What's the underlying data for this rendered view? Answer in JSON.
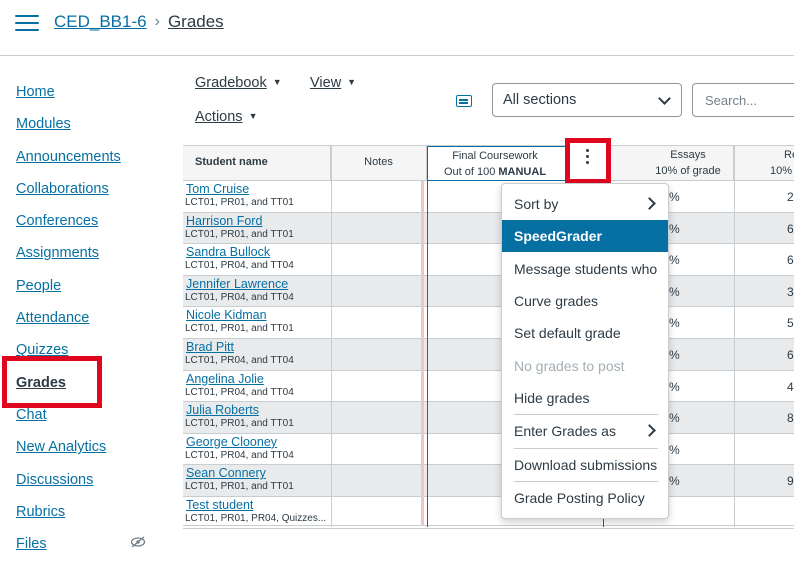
{
  "header": {
    "course": "CED_BB1-6",
    "separator": "›",
    "current": "Grades"
  },
  "sidenav": {
    "items": [
      {
        "label": "Home"
      },
      {
        "label": "Modules"
      },
      {
        "label": "Announcements"
      },
      {
        "label": "Collaborations"
      },
      {
        "label": "Conferences"
      },
      {
        "label": "Assignments"
      },
      {
        "label": "People"
      },
      {
        "label": "Attendance"
      },
      {
        "label": "Quizzes"
      },
      {
        "label": "Grades"
      },
      {
        "label": "Chat"
      },
      {
        "label": "New Analytics"
      },
      {
        "label": "Discussions"
      },
      {
        "label": "Rubrics"
      },
      {
        "label": "Files"
      }
    ],
    "files_icon": "eye-slash-icon"
  },
  "toolbar": {
    "gradebook": "Gradebook",
    "view": "View",
    "actions": "Actions",
    "caret": "▼",
    "sections_select": "All sections",
    "search_placeholder": "Search..."
  },
  "grid": {
    "headers": {
      "student": "Student name",
      "notes": "Notes",
      "final_title": "Final Coursework",
      "final_sub": "Out of 100",
      "final_flag": "MANUAL",
      "essays_title": "Essays",
      "essays_sub": "10% of grade",
      "next_title": "Re",
      "next_sub": "10%"
    },
    "rows": [
      {
        "name": "Tom Cruise",
        "sections": "LCT01, PR01, and TT01",
        "pct": "%",
        "next": "2"
      },
      {
        "name": "Harrison Ford",
        "sections": "LCT01, PR01, and TT01",
        "pct": "%",
        "next": "6"
      },
      {
        "name": "Sandra Bullock",
        "sections": "LCT01, PR04, and TT04",
        "pct": "%",
        "next": "6"
      },
      {
        "name": "Jennifer Lawrence",
        "sections": "LCT01, PR04, and TT04",
        "pct": "%",
        "next": "3"
      },
      {
        "name": "Nicole Kidman",
        "sections": "LCT01, PR01, and TT01",
        "pct": "%",
        "next": "5"
      },
      {
        "name": "Brad Pitt",
        "sections": "LCT01, PR04, and TT04",
        "pct": "%",
        "next": "6"
      },
      {
        "name": "Angelina Jolie",
        "sections": "LCT01, PR04, and TT04",
        "pct": "%",
        "next": "4"
      },
      {
        "name": "Julia Roberts",
        "sections": "LCT01, PR01, and TT01",
        "pct": "%",
        "next": "8"
      },
      {
        "name": "George Clooney",
        "sections": "LCT01, PR04, and TT04",
        "pct": "%",
        "next": ""
      },
      {
        "name": "Sean Connery",
        "sections": "LCT01, PR01, and TT01",
        "pct": "%",
        "next": "9"
      },
      {
        "name": "Test student",
        "sections": "LCT01, PR01, PR04, Quizzes...",
        "pct": "",
        "next": ""
      }
    ]
  },
  "menu": {
    "items": [
      {
        "label": "Sort by",
        "submenu": true
      },
      {
        "label": "SpeedGrader",
        "selected": true
      },
      {
        "label": "Message students who"
      },
      {
        "label": "Curve grades"
      },
      {
        "label": "Set default grade"
      },
      {
        "label": "No grades to post",
        "disabled": true
      },
      {
        "label": "Hide grades"
      },
      {
        "label": "Enter Grades as",
        "submenu": true
      },
      {
        "label": "Download submissions"
      },
      {
        "label": "Grade Posting Policy"
      }
    ]
  }
}
